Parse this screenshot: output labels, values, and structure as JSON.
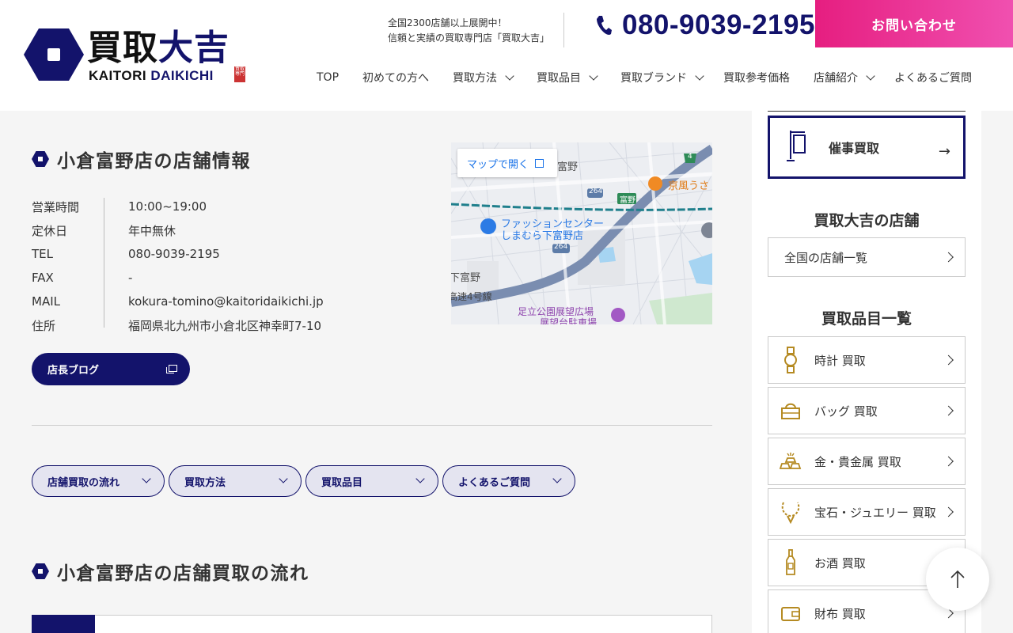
{
  "header": {
    "logo": {
      "title_a": "買取",
      "title_b": "大吉",
      "sub_a": "KAITORI ",
      "sub_b": "DAIKICHI",
      "stamp": "買取専門"
    },
    "tagline_1": "全国2300店舗以上展開中！",
    "tagline_2": "信頼と実績の買取専門店「買取大吉」",
    "phone": "080-9039-2195",
    "contact_label": "お問い合わせ",
    "nav": [
      {
        "label": "TOP",
        "dropdown": false
      },
      {
        "label": "初めての方へ",
        "dropdown": false
      },
      {
        "label": "買取方法",
        "dropdown": true
      },
      {
        "label": "買取品目",
        "dropdown": true
      },
      {
        "label": "買取ブランド",
        "dropdown": true
      },
      {
        "label": "買取参考価格",
        "dropdown": false
      },
      {
        "label": "店舗紹介",
        "dropdown": true
      },
      {
        "label": "よくあるご質問",
        "dropdown": false
      }
    ]
  },
  "store_info": {
    "title": "小倉富野店の店舗情報",
    "rows": [
      {
        "label": "営業時間",
        "value": "10:00~19:00"
      },
      {
        "label": "定休日",
        "value": "年中無休"
      },
      {
        "label": "TEL",
        "value": "080-9039-2195"
      },
      {
        "label": "FAX",
        "value": "-"
      },
      {
        "label": "MAIL",
        "value": "kokura-tomino@kaitoridaikichi.jp"
      },
      {
        "label": "住所",
        "value": "福岡県北九州市小倉北区神幸町7-10"
      }
    ],
    "blog_button": "店長ブログ"
  },
  "map": {
    "open_label": "マップで開く",
    "labels": {
      "tomino_top": "富野",
      "restaurant": "京風うさ",
      "route_264a": "264",
      "route_264b": "264",
      "tomino_sign": "富野",
      "route_4": "4",
      "shop_1": "ファッションセンター",
      "shop_2": "しまむら下富野店",
      "shimotomino": "下富野",
      "highway": "高速4号線",
      "park_1": "足立公園展望広場",
      "park_2": "展望台駐車場"
    }
  },
  "anchor_pills": [
    {
      "label": "店舗買取の流れ"
    },
    {
      "label": "買取方法"
    },
    {
      "label": "買取品目"
    },
    {
      "label": "よくあるご質問"
    }
  ],
  "flow": {
    "title": "小倉富野店の店舗買取の流れ"
  },
  "sidebar": {
    "event_label": "催事買取",
    "stores_heading": "買取大吉の店舗",
    "stores_link": "全国の店舗一覧",
    "items_heading": "買取品目一覧",
    "items": [
      {
        "label": "時計 買取",
        "icon": "watch-icon"
      },
      {
        "label": "バッグ 買取",
        "icon": "bag-icon"
      },
      {
        "label": "金・貴金属 買取",
        "icon": "gold-bars-icon"
      },
      {
        "label": "宝石・ジュエリー 買取",
        "icon": "jewelry-icon"
      },
      {
        "label": "お酒 買取",
        "icon": "bottle-icon"
      },
      {
        "label": "財布 買取",
        "icon": "wallet-icon"
      }
    ]
  },
  "colors": {
    "navy": "#13136b",
    "pink": "#e61e80",
    "gold": "#b58a22"
  }
}
